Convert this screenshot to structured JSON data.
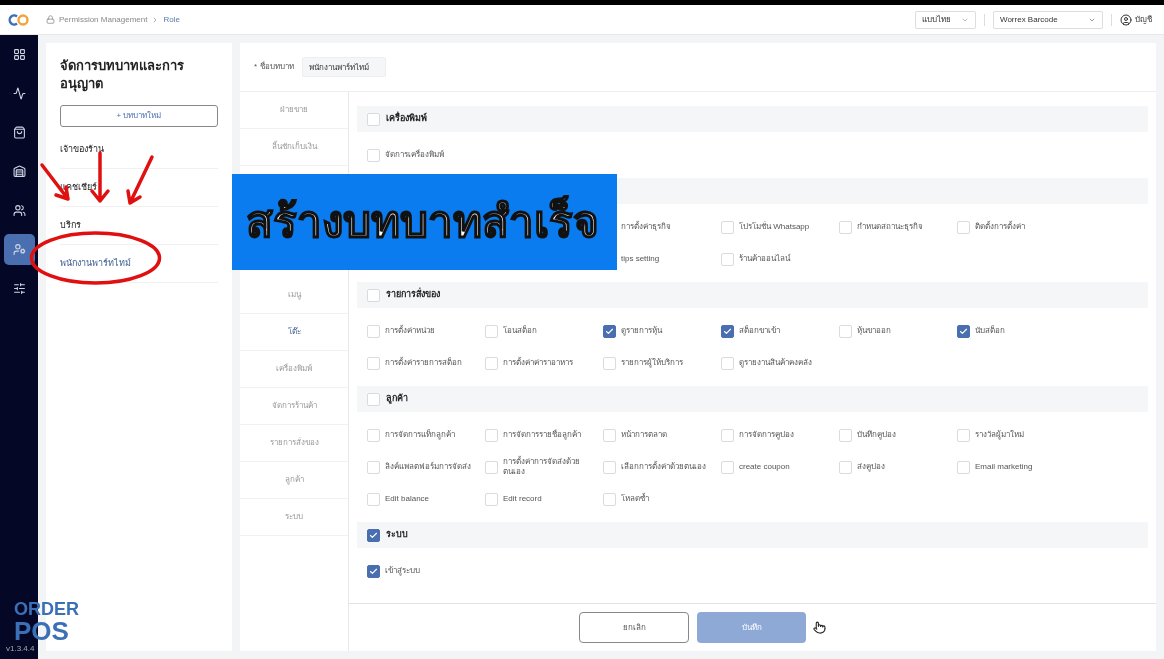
{
  "breadcrumb": [
    "Permission Management",
    "Role"
  ],
  "header": {
    "language": "แบบไทย",
    "store": "Worrex Barcode",
    "account": "บัญชี"
  },
  "sidebar": {
    "items": [
      {
        "selected": false
      },
      {
        "selected": false
      },
      {
        "selected": false
      },
      {
        "selected": false
      },
      {
        "selected": false
      },
      {
        "selected": true
      },
      {
        "selected": false
      }
    ],
    "logo": [
      "ORDER",
      "POS"
    ],
    "version": "v1.3.4.4"
  },
  "roles_panel": {
    "title": "จัดการบทบาทและการอนุญาต",
    "add_button": "+ บทบาทใหม่",
    "roles": [
      {
        "label": "เจ้าของร้าน",
        "selected": false
      },
      {
        "label": "แคชเชียร์",
        "selected": false
      },
      {
        "label": "บริกร",
        "selected": false
      },
      {
        "label": "พนักงานพาร์ทไทม์",
        "selected": true
      }
    ]
  },
  "role_name": {
    "required_mark": "*",
    "label": "ชื่อบทบาท",
    "value": "พนักงานพาร์ทไทม์"
  },
  "tabs_top": [
    {
      "label": "ฝ่ายขาย",
      "selected": false
    },
    {
      "label": "ลิ้นชักเก็บเงิน",
      "selected": false
    }
  ],
  "tabs_bottom": [
    {
      "label": "เมนู",
      "selected": false
    },
    {
      "label": "โต๊ะ",
      "selected": true
    },
    {
      "label": "เครื่องพิมพ์",
      "selected": false
    },
    {
      "label": "จัดการร้านค้า",
      "selected": false
    },
    {
      "label": "รายการสั่งของ",
      "selected": false
    },
    {
      "label": "ลูกค้า",
      "selected": false
    },
    {
      "label": "ระบบ",
      "selected": false
    }
  ],
  "sections": [
    {
      "title": "เครื่องพิมพ์",
      "checked": false,
      "rows": [
        [
          {
            "label": "จัดการเครื่องพิมพ์",
            "checked": false
          }
        ]
      ]
    },
    {
      "kind": "overlaid",
      "rows": [
        [
          {
            "label": "การตั้งค่าธุรกิจ"
          },
          {
            "label": "โปรโมชั่น Whatsapp",
            "checked": false
          },
          {
            "label": "กำหนดสถานะธุรกิจ",
            "checked": false
          },
          {
            "label": "ติดตั้งการตั้งค่า",
            "checked": false
          }
        ],
        [
          {
            "label": "tips setting"
          },
          {
            "label": "ร้านค้าออนไลน์",
            "checked": false
          }
        ]
      ]
    },
    {
      "title": "รายการสั่งของ",
      "checked": false,
      "rows": [
        [
          {
            "label": "การตั้งค่าหน่วย",
            "checked": false
          },
          {
            "label": "โอนสต็อก",
            "checked": false
          },
          {
            "label": "ดูรายการหุ้น",
            "checked": true
          },
          {
            "label": "สต็อกขาเข้า",
            "checked": true
          },
          {
            "label": "หุ้นขาออก",
            "checked": false
          },
          {
            "label": "นับสต็อก",
            "checked": true
          }
        ],
        [
          {
            "label": "การตั้งค่ารายการสต็อก",
            "checked": false
          },
          {
            "label": "การตั้งค่าค่าราอาหาร",
            "checked": false
          },
          {
            "label": "รายการผู้ให้บริการ",
            "checked": false
          },
          {
            "label": "ดูรายงานสินค้าคงคลัง",
            "checked": false
          }
        ]
      ]
    },
    {
      "title": "ลูกค้า",
      "checked": false,
      "rows": [
        [
          {
            "label": "การจัดการแท็กลูกค้า",
            "checked": false
          },
          {
            "label": "การจัดการรายชื่อลูกค้า",
            "checked": false
          },
          {
            "label": "หน้าการตลาด",
            "checked": false
          },
          {
            "label": "การจัดการคูปอง",
            "checked": false
          },
          {
            "label": "บันทึกคูปอง",
            "checked": false
          },
          {
            "label": "รางวัลผู้มาใหม่",
            "checked": false
          }
        ],
        [
          {
            "label": "ลิงค์แพลตฟอร์มการจัดส่ง",
            "checked": false
          },
          {
            "label": "การตั้งค่าการจัดส่งด้วยตนเอง",
            "checked": false
          },
          {
            "label": "เลือกการตั้งค่าด้วยตนเอง",
            "checked": false
          },
          {
            "label": "create coupon",
            "checked": false
          },
          {
            "label": "ส่งคูปอง",
            "checked": false
          },
          {
            "label": "Email marketing",
            "checked": false
          }
        ],
        [
          {
            "label": "Edit balance",
            "checked": false
          },
          {
            "label": "Edit record",
            "checked": false
          },
          {
            "label": "โหลดซ้ำ",
            "checked": false
          }
        ]
      ]
    },
    {
      "title": "ระบบ",
      "checked": true,
      "rows": [
        [
          {
            "label": "เข้าสู่ระบบ",
            "checked": true
          }
        ]
      ]
    }
  ],
  "footer": {
    "cancel": "ยกเลิก",
    "save": "บันทึก"
  },
  "banner": {
    "text": "สร้างบทบาทสำเร็จ"
  }
}
